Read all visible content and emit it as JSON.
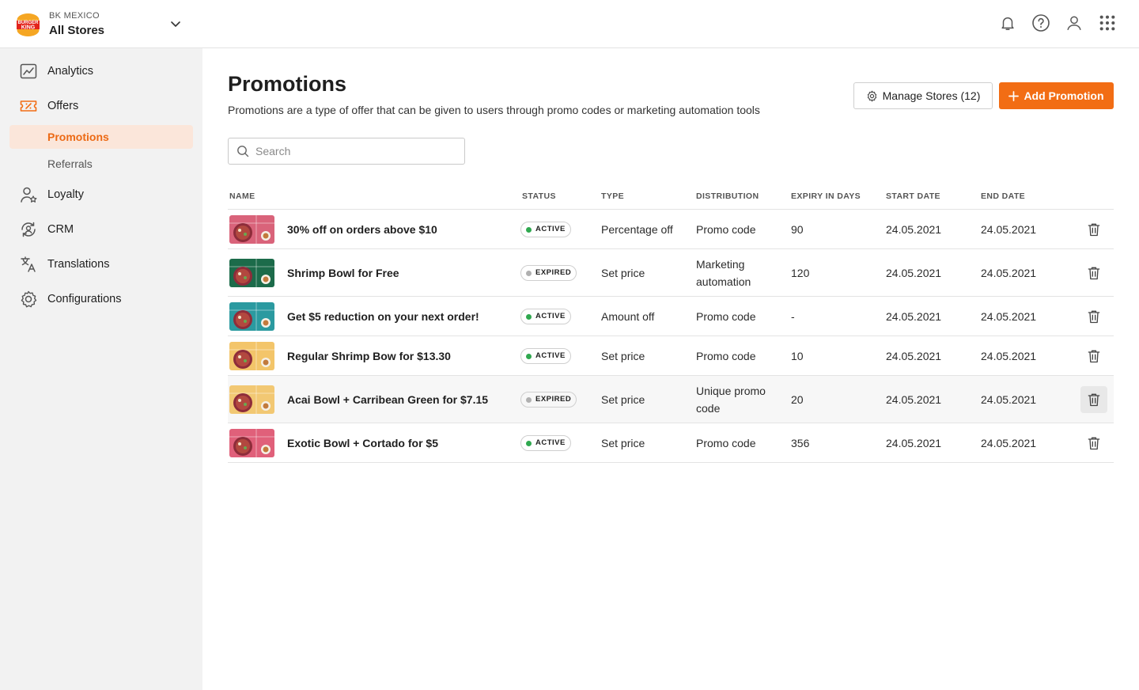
{
  "header": {
    "org": "BK MEXICO",
    "store": "All Stores",
    "icons": [
      "bell-icon",
      "help-icon",
      "user-icon",
      "apps-grid-icon"
    ]
  },
  "sidebar": {
    "items": [
      {
        "label": "Analytics",
        "icon": "analytics-icon"
      },
      {
        "label": "Offers",
        "icon": "offers-icon"
      },
      {
        "label": "Loyalty",
        "icon": "loyalty-icon"
      },
      {
        "label": "CRM",
        "icon": "crm-icon"
      },
      {
        "label": "Translations",
        "icon": "translations-icon"
      },
      {
        "label": "Configurations",
        "icon": "configurations-icon"
      }
    ],
    "offers_sub": [
      {
        "label": "Promotions",
        "selected": true
      },
      {
        "label": "Referrals",
        "selected": false
      }
    ]
  },
  "page": {
    "title": "Promotions",
    "description": "Promotions are a type of offer that can be given to users through promo codes or marketing automation tools",
    "manage_stores_label": "Manage Stores (12)",
    "add_promotion_label": "Add Promotion",
    "search_placeholder": "Search"
  },
  "table": {
    "columns": [
      "NAME",
      "STATUS",
      "TYPE",
      "DISTRIBUTION",
      "EXPIRY IN DAYS",
      "START DATE",
      "END DATE"
    ],
    "rows": [
      {
        "name": "30% off on orders above $10",
        "status": "ACTIVE",
        "type": "Percentage off",
        "distribution": "Promo code",
        "expiry": "90",
        "start": "24.05.2021",
        "end": "24.05.2021",
        "thumb_bg": "#d9637a"
      },
      {
        "name": "Shrimp Bowl for Free",
        "status": "EXPIRED",
        "type": "Set price",
        "distribution": "Marketing automation",
        "expiry": "120",
        "start": "24.05.2021",
        "end": "24.05.2021",
        "thumb_bg": "#1c6b4a"
      },
      {
        "name": "Get $5 reduction on your next order!",
        "status": "ACTIVE",
        "type": "Amount off",
        "distribution": "Promo code",
        "expiry": "-",
        "start": "24.05.2021",
        "end": "24.05.2021",
        "thumb_bg": "#2b9aa0"
      },
      {
        "name": "Regular Shrimp Bow for $13.30",
        "status": "ACTIVE",
        "type": "Set price",
        "distribution": "Promo code",
        "expiry": "10",
        "start": "24.05.2021",
        "end": "24.05.2021",
        "thumb_bg": "#f3c56a"
      },
      {
        "name": "Acai Bowl + Carribean Green for $7.15",
        "status": "EXPIRED",
        "type": "Set price",
        "distribution": "Unique promo code",
        "expiry": "20",
        "start": "24.05.2021",
        "end": "24.05.2021",
        "thumb_bg": "#f2c873"
      },
      {
        "name": "Exotic Bowl + Cortado for $5",
        "status": "ACTIVE",
        "type": "Set price",
        "distribution": "Promo code",
        "expiry": "356",
        "start": "24.05.2021",
        "end": "24.05.2021",
        "thumb_bg": "#e0607a"
      }
    ]
  },
  "colors": {
    "accent": "#f26d14",
    "active_dot": "#2fa84f",
    "expired_dot": "#b0b0b0",
    "selected_bg": "#fbe6da"
  }
}
